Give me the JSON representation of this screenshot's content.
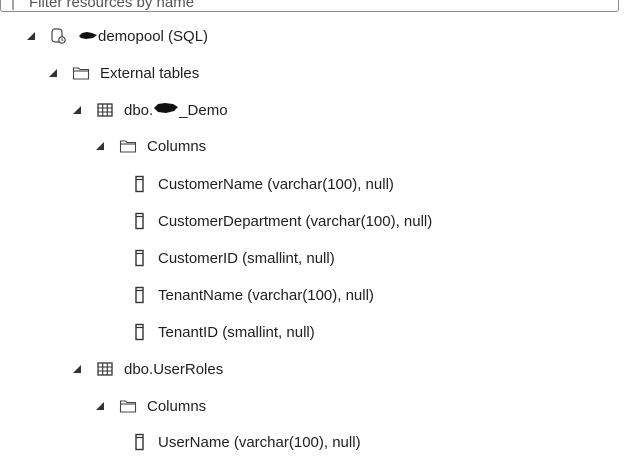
{
  "filter": {
    "placeholder": "Filter resources by name"
  },
  "tree": {
    "pool": {
      "prefix": "",
      "label": "demopool (SQL)"
    },
    "external_tables": {
      "label": "External tables"
    },
    "table1": {
      "prefix": "dbo.",
      "label": "_Demo",
      "columns_label": "Columns",
      "columns": [
        "CustomerName (varchar(100), null)",
        "CustomerDepartment (varchar(100), null)",
        "CustomerID (smallint, null)",
        "TenantName (varchar(100), null)",
        "TenantID (smallint, null)"
      ]
    },
    "table2": {
      "label": "dbo.UserRoles",
      "columns_label": "Columns",
      "columns": [
        "UserName (varchar(100), null)"
      ]
    }
  },
  "icons": {
    "expanded": "caret-down-icon",
    "database": "database-icon",
    "folder": "folder-icon",
    "table": "table-icon",
    "column": "column-icon"
  }
}
